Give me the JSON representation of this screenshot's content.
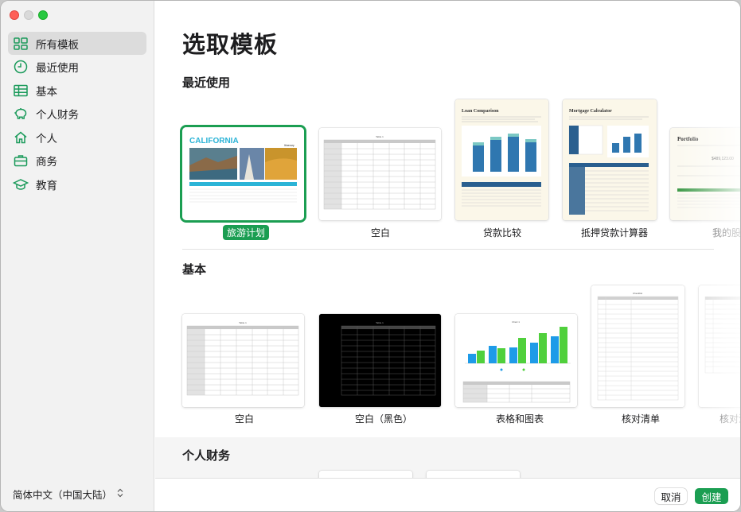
{
  "window": {
    "traffic_lights": {
      "close": "close-button",
      "minimize": "minimize-button",
      "zoom": "zoom-button"
    }
  },
  "sidebar": {
    "items": [
      {
        "label": "所有模板",
        "icon": "templates-icon",
        "active": true
      },
      {
        "label": "最近使用",
        "icon": "clock-icon",
        "active": false
      },
      {
        "label": "基本",
        "icon": "table-icon",
        "active": false
      },
      {
        "label": "个人财务",
        "icon": "piggy-bank-icon",
        "active": false
      },
      {
        "label": "个人",
        "icon": "house-icon",
        "active": false
      },
      {
        "label": "商务",
        "icon": "briefcase-icon",
        "active": false
      },
      {
        "label": "教育",
        "icon": "graduation-cap-icon",
        "active": false
      }
    ],
    "language": "简体中文（中国大陆）",
    "language_chevron": "⌃⌄"
  },
  "main": {
    "title": "选取模板",
    "sections": {
      "recent": {
        "title": "最近使用",
        "templates": [
          {
            "caption": "旅游计划",
            "selected": true
          },
          {
            "caption": "空白"
          },
          {
            "caption": "贷款比较"
          },
          {
            "caption": "抵押贷款计算器"
          },
          {
            "caption": "我的股"
          }
        ]
      },
      "basic": {
        "title": "基本",
        "templates": [
          {
            "caption": "空白"
          },
          {
            "caption": "空白（黑色）"
          },
          {
            "caption": "表格和图表"
          },
          {
            "caption": "核对清单"
          },
          {
            "caption": "核对清"
          }
        ]
      },
      "personal_finance": {
        "title": "个人财务"
      }
    },
    "thumb_text": {
      "california": "CALIFORNIA",
      "itinerary": "Itinerary",
      "loan_title": "Loan Comparison",
      "mortgage_title": "Mortgage Calculator",
      "portfolio_title": "Portfolio",
      "portfolio_value": "$489,123.00",
      "sheet_title": "Table 1",
      "chart_title": "Chart 1",
      "checklist_title": "Checklist"
    }
  },
  "footer": {
    "cancel": "取消",
    "create": "创建"
  },
  "colors": {
    "accent": "#1b9e52",
    "sidebar_bg": "#f2f2f2"
  }
}
